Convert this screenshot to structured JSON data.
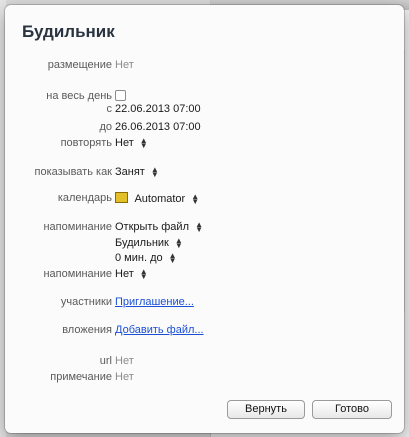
{
  "popover": {
    "title": "Будильник",
    "rows": {
      "location": {
        "label": "размещение",
        "value": "Нет"
      },
      "all_day": {
        "label": "на весь день"
      },
      "from": {
        "label": "с",
        "value": "22.06.2013  07:00"
      },
      "to": {
        "label": "до",
        "value": "26.06.2013  07:00"
      },
      "repeat": {
        "label": "повторять",
        "value": "Нет"
      },
      "show_as": {
        "label": "показывать как",
        "value": "Занят"
      },
      "calendar": {
        "label": "календарь",
        "value": "Automator",
        "color": "#e3bf2a"
      },
      "alert1": {
        "label": "напоминание",
        "action": "Открыть файл",
        "file": "Будильник",
        "offset": "0  мин. до"
      },
      "alert2": {
        "label": "напоминание",
        "value": "Нет"
      },
      "invitees": {
        "label": "участники",
        "value": "Приглашение..."
      },
      "attachments": {
        "label": "вложения",
        "value": "Добавить файл..."
      },
      "url": {
        "label": "url",
        "value": "Нет"
      },
      "note": {
        "label": "примечание",
        "value": "Нет"
      }
    },
    "buttons": {
      "revert": "Вернуть",
      "done": "Готово"
    }
  }
}
